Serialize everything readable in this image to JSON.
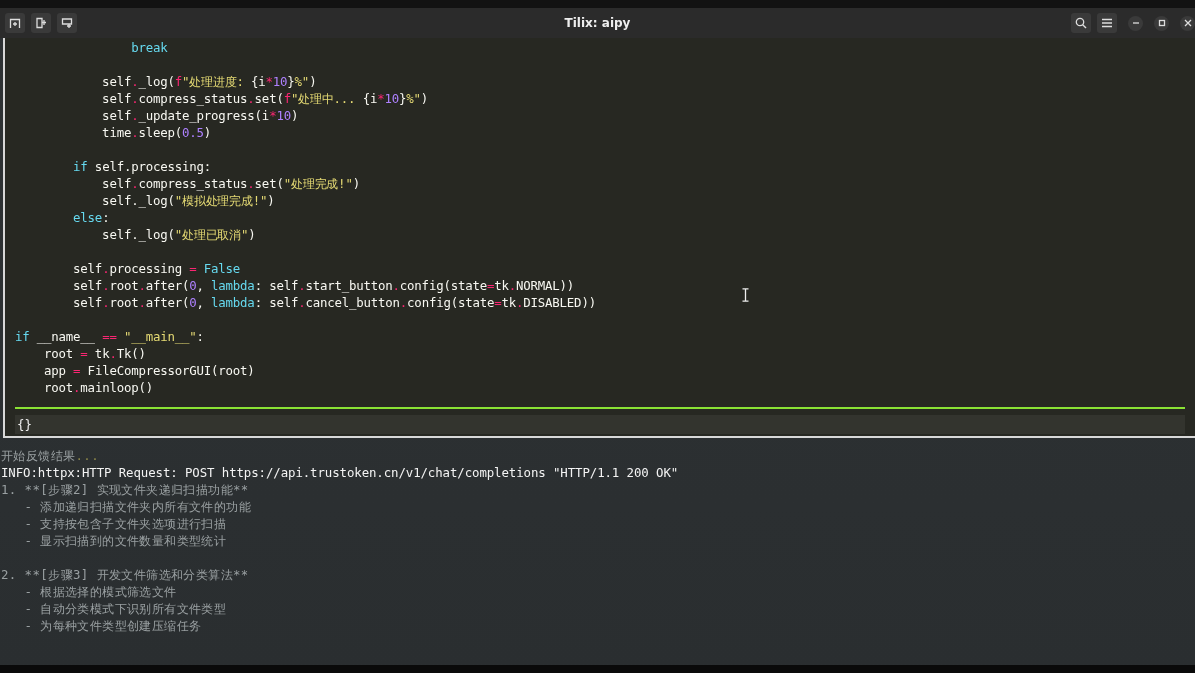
{
  "window": {
    "title": "Tilix: aipy"
  },
  "code_lines": [
    {
      "kind": "code",
      "tokens": [
        {
          "kind": "k",
          "text": "                break"
        }
      ]
    },
    {
      "kind": "blank"
    },
    {
      "kind": "code",
      "tokens": [
        {
          "kind": "p",
          "text": "            self"
        },
        {
          "kind": "o",
          "text": "."
        },
        {
          "kind": "p",
          "text": "_log("
        },
        {
          "kind": "f",
          "text": "f"
        },
        {
          "kind": "s",
          "text": "\"处理进度: "
        },
        {
          "kind": "p",
          "text": "{i"
        },
        {
          "kind": "o",
          "text": "*"
        },
        {
          "kind": "n",
          "text": "10"
        },
        {
          "kind": "p",
          "text": "}"
        },
        {
          "kind": "s",
          "text": "%\""
        },
        {
          "kind": "p",
          "text": ")"
        }
      ]
    },
    {
      "kind": "code",
      "tokens": [
        {
          "kind": "p",
          "text": "            self"
        },
        {
          "kind": "o",
          "text": "."
        },
        {
          "kind": "p",
          "text": "compress_status"
        },
        {
          "kind": "o",
          "text": "."
        },
        {
          "kind": "p",
          "text": "set("
        },
        {
          "kind": "f",
          "text": "f"
        },
        {
          "kind": "s",
          "text": "\"处理中... "
        },
        {
          "kind": "p",
          "text": "{i"
        },
        {
          "kind": "o",
          "text": "*"
        },
        {
          "kind": "n",
          "text": "10"
        },
        {
          "kind": "p",
          "text": "}"
        },
        {
          "kind": "s",
          "text": "%\""
        },
        {
          "kind": "p",
          "text": ")"
        }
      ]
    },
    {
      "kind": "code",
      "tokens": [
        {
          "kind": "p",
          "text": "            self"
        },
        {
          "kind": "o",
          "text": "."
        },
        {
          "kind": "p",
          "text": "_update_progress(i"
        },
        {
          "kind": "o",
          "text": "*"
        },
        {
          "kind": "n",
          "text": "10"
        },
        {
          "kind": "p",
          "text": ")"
        }
      ]
    },
    {
      "kind": "code",
      "tokens": [
        {
          "kind": "p",
          "text": "            time"
        },
        {
          "kind": "o",
          "text": "."
        },
        {
          "kind": "p",
          "text": "sleep("
        },
        {
          "kind": "n",
          "text": "0.5"
        },
        {
          "kind": "p",
          "text": ")"
        }
      ]
    },
    {
      "kind": "blank"
    },
    {
      "kind": "code",
      "tokens": [
        {
          "kind": "k",
          "text": "        if"
        },
        {
          "kind": "p",
          "text": " self.processing:"
        }
      ]
    },
    {
      "kind": "code",
      "tokens": [
        {
          "kind": "p",
          "text": "            self"
        },
        {
          "kind": "o",
          "text": "."
        },
        {
          "kind": "p",
          "text": "compress_status"
        },
        {
          "kind": "o",
          "text": "."
        },
        {
          "kind": "p",
          "text": "set("
        },
        {
          "kind": "s",
          "text": "\"处理完成!\""
        },
        {
          "kind": "p",
          "text": ")"
        }
      ]
    },
    {
      "kind": "code",
      "tokens": [
        {
          "kind": "p",
          "text": "            self._log("
        },
        {
          "kind": "s",
          "text": "\"模拟处理完成!\""
        },
        {
          "kind": "p",
          "text": ")"
        }
      ]
    },
    {
      "kind": "code",
      "tokens": [
        {
          "kind": "k",
          "text": "        else"
        },
        {
          "kind": "p",
          "text": ":"
        }
      ]
    },
    {
      "kind": "code",
      "tokens": [
        {
          "kind": "p",
          "text": "            self._log("
        },
        {
          "kind": "s",
          "text": "\"处理已取消\""
        },
        {
          "kind": "p",
          "text": ")"
        }
      ]
    },
    {
      "kind": "blank"
    },
    {
      "kind": "code",
      "tokens": [
        {
          "kind": "p",
          "text": "        self"
        },
        {
          "kind": "o",
          "text": "."
        },
        {
          "kind": "p",
          "text": "processing "
        },
        {
          "kind": "o",
          "text": "="
        },
        {
          "kind": "k",
          "text": " False"
        }
      ]
    },
    {
      "kind": "code",
      "tokens": [
        {
          "kind": "p",
          "text": "        self"
        },
        {
          "kind": "o",
          "text": "."
        },
        {
          "kind": "p",
          "text": "root"
        },
        {
          "kind": "o",
          "text": "."
        },
        {
          "kind": "p",
          "text": "after("
        },
        {
          "kind": "n",
          "text": "0"
        },
        {
          "kind": "p",
          "text": ", "
        },
        {
          "kind": "k",
          "text": "lambda"
        },
        {
          "kind": "p",
          "text": ": self"
        },
        {
          "kind": "o",
          "text": "."
        },
        {
          "kind": "p",
          "text": "start_button"
        },
        {
          "kind": "o",
          "text": "."
        },
        {
          "kind": "p",
          "text": "config(state"
        },
        {
          "kind": "o",
          "text": "="
        },
        {
          "kind": "p",
          "text": "tk"
        },
        {
          "kind": "o",
          "text": "."
        },
        {
          "kind": "p",
          "text": "NORMAL))"
        }
      ]
    },
    {
      "kind": "code",
      "tokens": [
        {
          "kind": "p",
          "text": "        self"
        },
        {
          "kind": "o",
          "text": "."
        },
        {
          "kind": "p",
          "text": "root"
        },
        {
          "kind": "o",
          "text": "."
        },
        {
          "kind": "p",
          "text": "after("
        },
        {
          "kind": "n",
          "text": "0"
        },
        {
          "kind": "p",
          "text": ", "
        },
        {
          "kind": "k",
          "text": "lambda"
        },
        {
          "kind": "p",
          "text": ": self"
        },
        {
          "kind": "o",
          "text": "."
        },
        {
          "kind": "p",
          "text": "cancel_button"
        },
        {
          "kind": "o",
          "text": "."
        },
        {
          "kind": "p",
          "text": "config(state"
        },
        {
          "kind": "o",
          "text": "="
        },
        {
          "kind": "p",
          "text": "tk"
        },
        {
          "kind": "o",
          "text": "."
        },
        {
          "kind": "p",
          "text": "DISABLED))"
        }
      ]
    },
    {
      "kind": "blank"
    },
    {
      "kind": "code",
      "tokens": [
        {
          "kind": "k",
          "text": "if"
        },
        {
          "kind": "p",
          "text": " __name__ "
        },
        {
          "kind": "o",
          "text": "=="
        },
        {
          "kind": "s",
          "text": " \"__main__\""
        },
        {
          "kind": "p",
          "text": ":"
        }
      ]
    },
    {
      "kind": "code",
      "tokens": [
        {
          "kind": "p",
          "text": "    root "
        },
        {
          "kind": "o",
          "text": "="
        },
        {
          "kind": "p",
          "text": " tk"
        },
        {
          "kind": "o",
          "text": "."
        },
        {
          "kind": "p",
          "text": "Tk()"
        }
      ]
    },
    {
      "kind": "code",
      "tokens": [
        {
          "kind": "p",
          "text": "    app "
        },
        {
          "kind": "o",
          "text": "="
        },
        {
          "kind": "p",
          "text": " FileCompressorGUI(root)"
        }
      ]
    },
    {
      "kind": "code",
      "tokens": [
        {
          "kind": "p",
          "text": "    root"
        },
        {
          "kind": "o",
          "text": "."
        },
        {
          "kind": "p",
          "text": "mainloop()"
        }
      ]
    }
  ],
  "input": {
    "value": "{}"
  },
  "output_lines": [
    {
      "kind": "muted",
      "text": "开始反馈结果",
      "suffix": "..."
    },
    {
      "kind": "info",
      "text": "INFO:httpx:HTTP Request: POST https://api.trustoken.cn/v1/chat/completions \"HTTP/1.1 200 OK\""
    },
    {
      "kind": "muted",
      "text": "1. **[步骤2] 实现文件夹递归扫描功能**"
    },
    {
      "kind": "muted",
      "text": "   - 添加递归扫描文件夹内所有文件的功能"
    },
    {
      "kind": "muted",
      "text": "   - 支持按包含子文件夹选项进行扫描"
    },
    {
      "kind": "muted",
      "text": "   - 显示扫描到的文件数量和类型统计"
    },
    {
      "kind": "blank"
    },
    {
      "kind": "muted",
      "text": "2. **[步骤3] 开发文件筛选和分类算法**"
    },
    {
      "kind": "muted",
      "text": "   - 根据选择的模式筛选文件"
    },
    {
      "kind": "muted",
      "text": "   - 自动分类模式下识别所有文件类型"
    },
    {
      "kind": "muted",
      "text": "   - 为每种文件类型创建压缩任务"
    }
  ]
}
